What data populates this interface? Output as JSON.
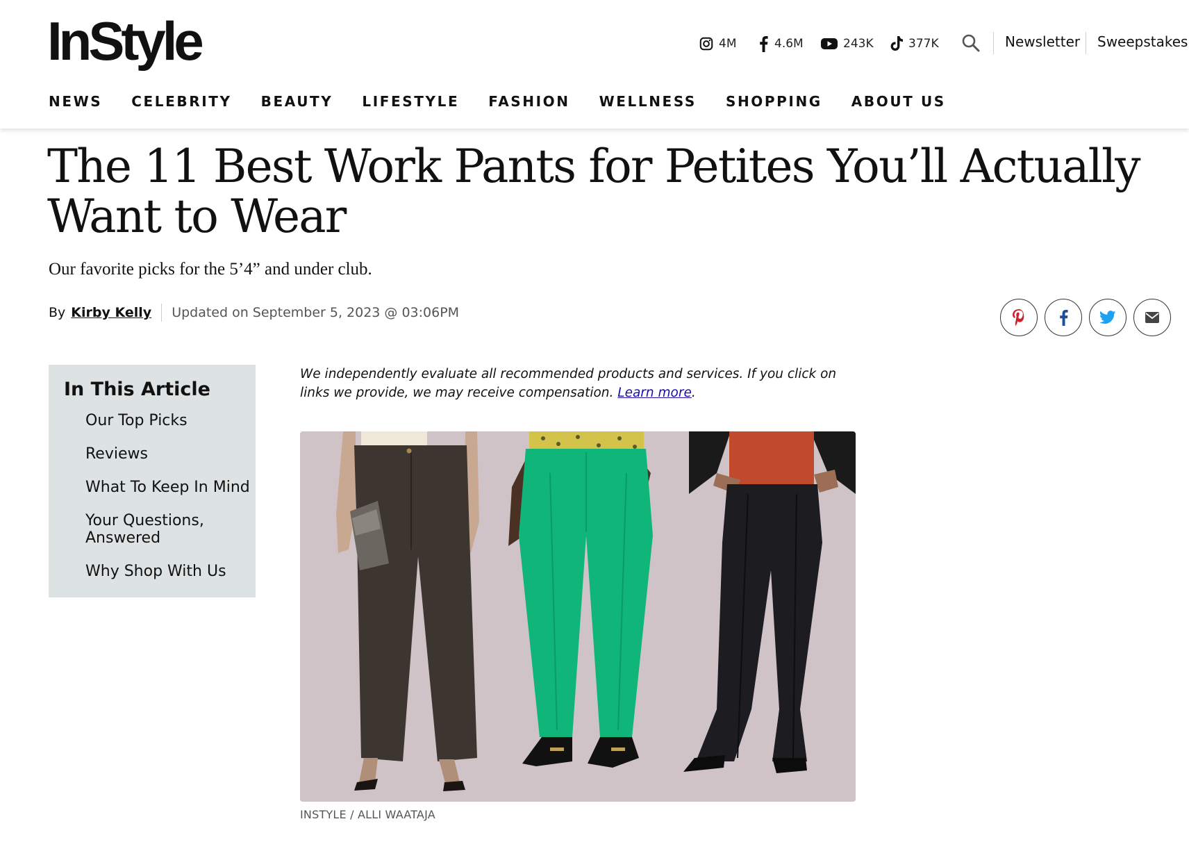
{
  "brand": {
    "logo_text": "InStyle"
  },
  "social": [
    {
      "icon": "instagram-icon",
      "count": "4M"
    },
    {
      "icon": "facebook-icon",
      "count": "4.6M"
    },
    {
      "icon": "youtube-icon",
      "count": "243K"
    },
    {
      "icon": "tiktok-icon",
      "count": "377K"
    }
  ],
  "header_links": {
    "newsletter": "Newsletter",
    "sweepstakes": "Sweepstakes"
  },
  "nav": [
    "NEWS",
    "CELEBRITY",
    "BEAUTY",
    "LIFESTYLE",
    "FASHION",
    "WELLNESS",
    "SHOPPING",
    "ABOUT US"
  ],
  "article": {
    "title": "The 11 Best Work Pants for Petites You’ll Actually Want to Wear",
    "dek": "Our favorite picks for the 5’4” and under club.",
    "by_label": "By",
    "author": "Kirby Kelly",
    "updated": "Updated on September 5, 2023 @ 03:06PM",
    "share": [
      "pinterest-icon",
      "facebook-icon",
      "twitter-icon",
      "email-icon"
    ],
    "disclaimer_text": "We independently evaluate all recommended products and services. If you click on links we provide, we may receive compensation. ",
    "learn_more": "Learn more",
    "image_credit": "INSTYLE / ALLI WAATAJA"
  },
  "toc": {
    "title": "In This Article",
    "items": [
      "Our Top Picks",
      "Reviews",
      "What To Keep In Mind",
      "Your Questions, Answered",
      "Why Shop With Us"
    ]
  },
  "colors": {
    "toc_bg": "#dde2e3",
    "pinterest": "#c8232c",
    "facebook": "#1d4f91",
    "twitter": "#1da1f2",
    "link": "#1a0dab",
    "hero_bg": "#cfc3c8",
    "pants_green": "#10b57a"
  }
}
